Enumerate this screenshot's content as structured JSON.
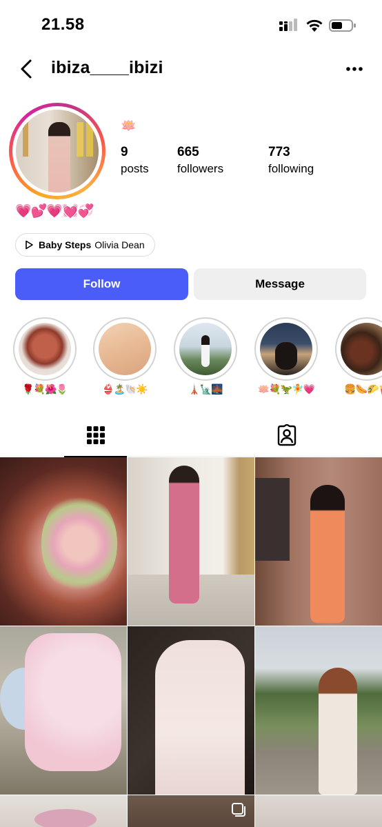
{
  "status_bar": {
    "time": "21.58"
  },
  "header": {
    "username": "ibiza____ibizi"
  },
  "profile": {
    "name_emojis": "💗💕💗💓💞",
    "bio_emoji": "🪷",
    "stats": [
      {
        "value": "9",
        "label": "posts"
      },
      {
        "value": "665",
        "label": "followers"
      },
      {
        "value": "773",
        "label": "following"
      }
    ],
    "music": {
      "song": "Baby Steps",
      "artist": "Olivia Dean"
    },
    "follow_label": "Follow",
    "message_label": "Message"
  },
  "highlights": [
    {
      "label": "🌹💐🌺🌷"
    },
    {
      "label": "👙🏝️🐚☀️"
    },
    {
      "label": "🗼🗽🌉"
    },
    {
      "label": "🪷💐🦖🧚💗"
    },
    {
      "label": "🍔🌭🌮🍟"
    }
  ],
  "colors": {
    "accent": "#4a5df9",
    "button_secondary": "#efefef"
  }
}
